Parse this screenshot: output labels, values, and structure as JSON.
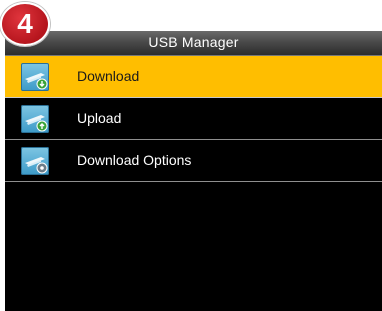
{
  "step_badge": "4",
  "header": {
    "title": "USB Manager"
  },
  "menu": {
    "items": [
      {
        "label": "Download",
        "icon": "usb-download-icon",
        "selected": true
      },
      {
        "label": "Upload",
        "icon": "usb-upload-icon",
        "selected": false
      },
      {
        "label": "Download Options",
        "icon": "usb-download-options-icon",
        "selected": false
      }
    ]
  },
  "colors": {
    "selected": "#ffbe00",
    "background": "#000000",
    "badge": "#d0252d"
  }
}
